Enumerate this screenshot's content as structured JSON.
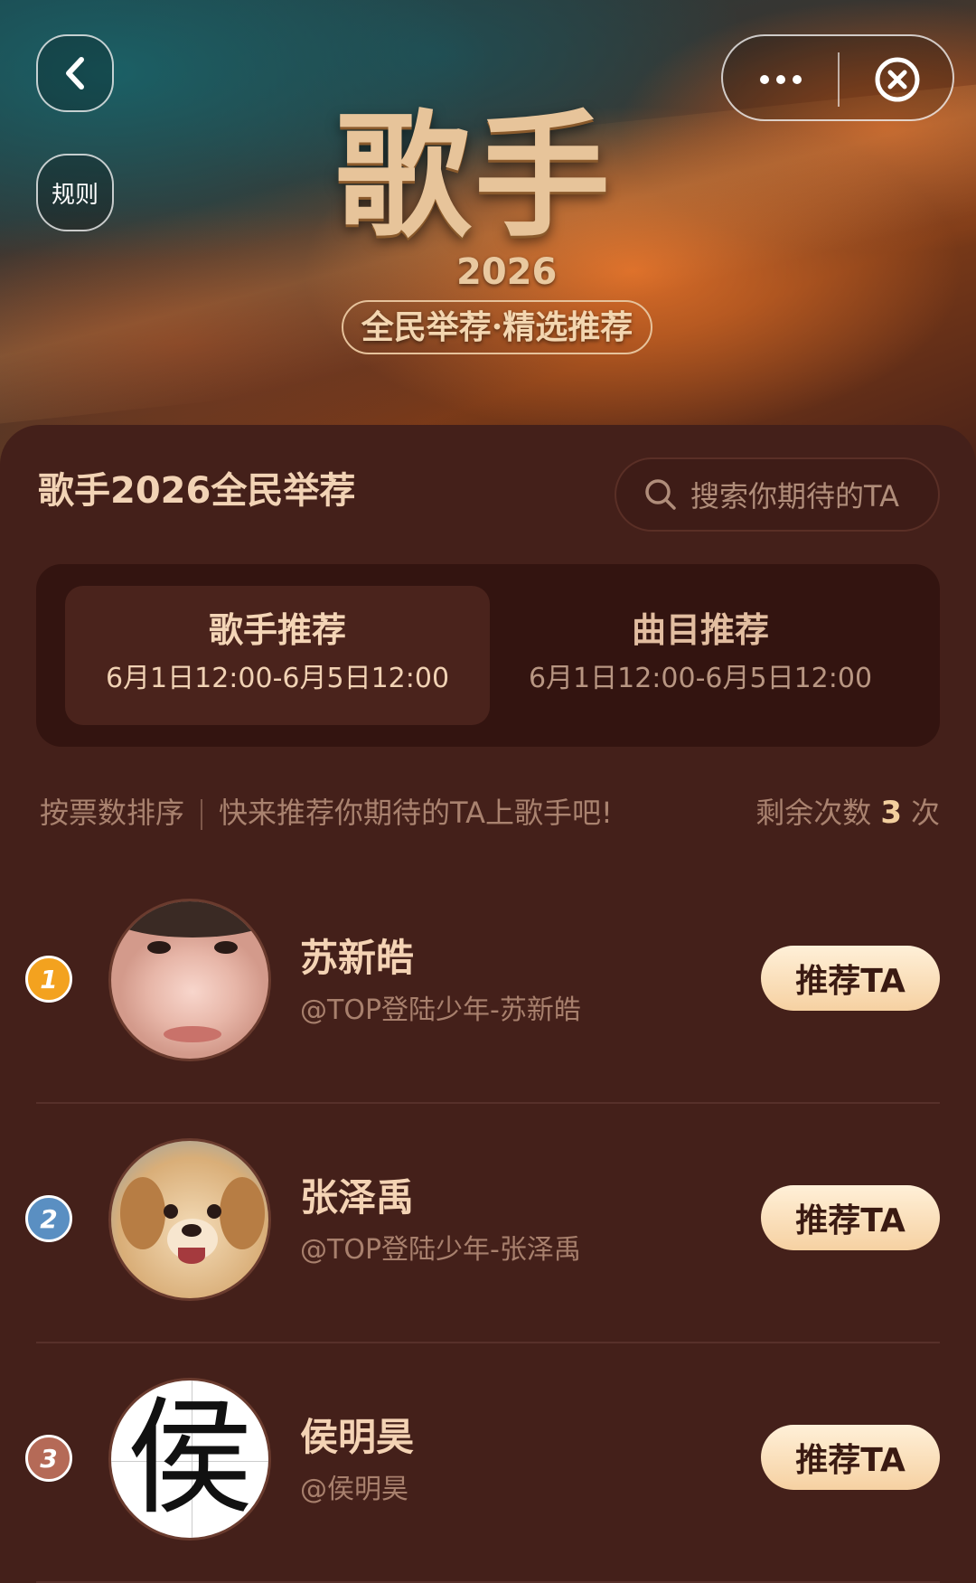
{
  "header": {
    "logo_title": "歌手",
    "logo_year": "2026",
    "logo_slogan": "全民举荐·精选推荐",
    "rules_label": "规则"
  },
  "page": {
    "title": "歌手2026全民举荐"
  },
  "search": {
    "placeholder": "搜索你期待的TA"
  },
  "tabs": [
    {
      "label": "歌手推荐",
      "time": "6月1日12:00-6月5日12:00",
      "active": true
    },
    {
      "label": "曲目推荐",
      "time": "6月1日12:00-6月5日12:00",
      "active": false
    }
  ],
  "hint": {
    "sort_label": "按票数排序",
    "cta": "快来推荐你期待的TA上歌手吧!",
    "remaining_prefix": "剩余次数",
    "remaining_count": "3",
    "remaining_suffix": "次"
  },
  "candidates": [
    {
      "rank": "1",
      "rank_color": "#f3a21f",
      "name": "苏新皓",
      "handle": "@TOP登陆少年-苏新皓",
      "button": "推荐TA"
    },
    {
      "rank": "2",
      "rank_color": "#5a8fc2",
      "name": "张泽禹",
      "handle": "@TOP登陆少年-张泽禹",
      "button": "推荐TA"
    },
    {
      "rank": "3",
      "rank_color": "#b56a57",
      "name": "侯明昊",
      "handle": "@侯明昊",
      "button": "推荐TA",
      "avatar_char": "侯"
    }
  ],
  "colors": {
    "background": "#44201a",
    "tab_container": "#331410",
    "button_gradient_top": "#fff0d8",
    "button_gradient_bottom": "#f6d1a2",
    "accent_text": "#f3cf9e"
  }
}
